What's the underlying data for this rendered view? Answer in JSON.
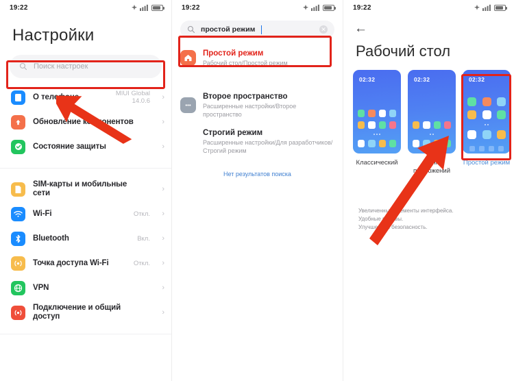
{
  "statusbar": {
    "time": "19:22"
  },
  "panel1": {
    "title": "Настройки",
    "search_placeholder": "Поиск настроек",
    "items": [
      {
        "label": "О телефоне",
        "value": "MIUI Global\n14.0.6",
        "icon": "phone-icon",
        "color": "#1a8cff"
      },
      {
        "label": "Обновление компонентов",
        "value": "",
        "icon": "update-arrow-icon",
        "color": "#f4704a"
      },
      {
        "label": "Состояние защиты",
        "value": "",
        "icon": "shield-check-icon",
        "color": "#22c55e"
      },
      {
        "label": "SIM-карты и мобильные сети",
        "value": "",
        "icon": "sim-card-icon",
        "color": "#f7bc4c"
      },
      {
        "label": "Wi-Fi",
        "value": "Откл.",
        "icon": "wifi-icon",
        "color": "#1a8cff"
      },
      {
        "label": "Bluetooth",
        "value": "Вкл.",
        "icon": "bluetooth-icon",
        "color": "#1a8cff"
      },
      {
        "label": "Точка доступа Wi-Fi",
        "value": "Откл.",
        "icon": "hotspot-icon",
        "color": "#f7bc4c"
      },
      {
        "label": "VPN",
        "value": "",
        "icon": "globe-icon",
        "color": "#22c55e"
      },
      {
        "label": "Подключение и общий доступ",
        "value": "",
        "icon": "share-connection-icon",
        "color": "#ef4e3a"
      }
    ],
    "chevron": "›"
  },
  "panel2": {
    "query": "простой режим",
    "clear_label": "✕",
    "results": [
      {
        "title": "Простой режим",
        "subtitle": "Рабочий стол/Простой режим",
        "icon": "home-icon",
        "color": "#f4704a",
        "highlighted": true
      },
      {
        "title": "Второе пространство",
        "subtitle": "Расширенные настройки/Второе пространство",
        "icon": "second-space-icon",
        "color": "#9aa4b0",
        "highlighted": false
      },
      {
        "title": "Строгий режим",
        "subtitle": "Расширенные настройки/Для разработчиков/Строгий режим",
        "icon": "",
        "color": "",
        "highlighted": false
      }
    ],
    "no_results": "Нет результатов поиска"
  },
  "panel3": {
    "back_icon": "←",
    "title": "Рабочий стол",
    "phone_clock": "02:32",
    "modes": [
      {
        "label": "Классический",
        "selected": false
      },
      {
        "label": "Меню приложений",
        "selected": false
      },
      {
        "label": "Простой режим",
        "selected": true
      }
    ],
    "description": "Увеличенные элементы интерфейса.\nУдобные вызовы.\nУлучшенная безопасность."
  },
  "colors": {
    "accent_red": "#e2231a",
    "link_blue": "#3f7fd0",
    "selected_blue": "#4b8bd6"
  },
  "app_grids": {
    "classic": [
      [
        "#5fe0a4",
        "#f58a5e",
        "#ffffff",
        "#8fd4f7"
      ],
      [
        "#f7bc4c",
        "#ffffff",
        "#5fe0a4",
        "#f4758c"
      ],
      [
        "#ffffff",
        "#8fd4f7",
        "#f7bc4c",
        "#5fe0a4"
      ]
    ],
    "appmenu": [
      [
        "#f7bc4c",
        "#ffffff",
        "#5fe0a4",
        "#f4758c"
      ],
      [
        "#ffffff",
        "#8fd4f7",
        "#f7bc4c",
        "#5fe0a4"
      ]
    ],
    "simple": [
      [
        "#5fe0a4",
        "#f58a5e",
        "#8fd4f7"
      ],
      [
        "#f7bc4c",
        "#ffffff",
        "#5fe0a4"
      ],
      [
        "#ffffff",
        "#8fd4f7",
        "#f7bc4c"
      ]
    ]
  }
}
